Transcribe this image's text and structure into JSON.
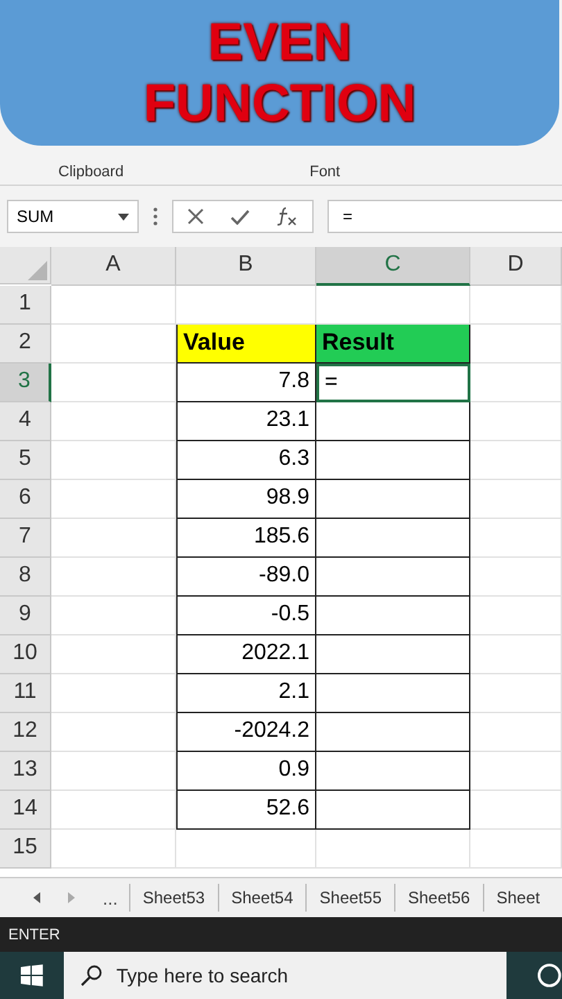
{
  "banner": {
    "lines": [
      "EVEN",
      "FUNCTION"
    ]
  },
  "ribbon": {
    "groups": [
      {
        "label": "Clipboard"
      },
      {
        "label": "Font"
      }
    ]
  },
  "formula_bar": {
    "name_box": "SUM",
    "formula": "="
  },
  "columns": [
    {
      "label": "A",
      "selected": false
    },
    {
      "label": "B",
      "selected": false
    },
    {
      "label": "C",
      "selected": true
    },
    {
      "label": "D",
      "selected": false
    }
  ],
  "rows": [
    {
      "number": "1",
      "selected": false,
      "kind": "blank"
    },
    {
      "number": "2",
      "selected": false,
      "kind": "header",
      "b": {
        "text": "Value",
        "color": "#ffff00"
      },
      "c": {
        "text": "Result",
        "color": "#22cc55"
      }
    },
    {
      "number": "3",
      "selected": true,
      "kind": "data",
      "b": "7.8",
      "c": "="
    },
    {
      "number": "4",
      "selected": false,
      "kind": "data",
      "b": "23.1"
    },
    {
      "number": "5",
      "selected": false,
      "kind": "data",
      "b": "6.3"
    },
    {
      "number": "6",
      "selected": false,
      "kind": "data",
      "b": "98.9"
    },
    {
      "number": "7",
      "selected": false,
      "kind": "data",
      "b": "185.6"
    },
    {
      "number": "8",
      "selected": false,
      "kind": "data",
      "b": "-89.0"
    },
    {
      "number": "9",
      "selected": false,
      "kind": "data",
      "b": "-0.5"
    },
    {
      "number": "10",
      "selected": false,
      "kind": "data",
      "b": "2022.1"
    },
    {
      "number": "11",
      "selected": false,
      "kind": "data",
      "b": "2.1"
    },
    {
      "number": "12",
      "selected": false,
      "kind": "data",
      "b": "-2024.2"
    },
    {
      "number": "13",
      "selected": false,
      "kind": "data",
      "b": "0.9"
    },
    {
      "number": "14",
      "selected": false,
      "kind": "data",
      "b": "52.6"
    },
    {
      "number": "15",
      "selected": false,
      "kind": "blank"
    }
  ],
  "sheet_tabs": {
    "more": "...",
    "tabs": [
      "Sheet53",
      "Sheet54",
      "Sheet55",
      "Sheet56",
      "Sheet"
    ]
  },
  "status_bar": {
    "mode": "ENTER"
  },
  "taskbar": {
    "search_placeholder": "Type here to search"
  }
}
